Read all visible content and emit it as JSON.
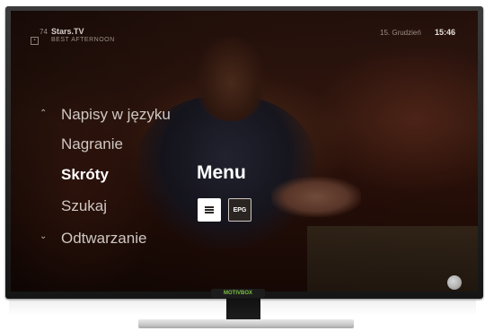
{
  "header": {
    "channel_number": "74",
    "channel_name": "Stars.TV",
    "program_icon": "program-icon",
    "program_title": "BEST AFTERNOON",
    "date": "15. Grudzień",
    "time": "15:46"
  },
  "menu": {
    "up_icon": "chevron-up-icon",
    "down_icon": "chevron-down-icon",
    "items": [
      {
        "label": "Napisy w języku",
        "selected": false
      },
      {
        "label": "Nagranie",
        "selected": false
      },
      {
        "label": "Skróty",
        "selected": true
      },
      {
        "label": "Szukaj",
        "selected": false
      },
      {
        "label": "Odtwarzanie",
        "selected": false
      }
    ]
  },
  "shortcuts": {
    "heading": "Menu",
    "buttons": [
      {
        "icon": "hamburger-menu-icon",
        "label": ""
      },
      {
        "icon": "epg-icon",
        "label": "EPG"
      }
    ]
  },
  "device": {
    "brand_label": "MOTIVBOX"
  },
  "colors": {
    "brand_green": "#7bc043",
    "selected_text": "#ffffff",
    "menu_text": "#cfc7c2"
  }
}
